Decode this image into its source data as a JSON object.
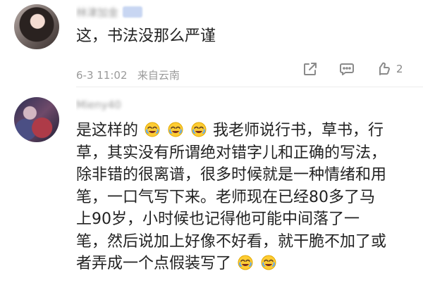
{
  "comments": [
    {
      "username": "林津加金",
      "text": "这，书法没那么严谨",
      "date": "6-3 11:02",
      "source": "来自云南",
      "likes": "2"
    },
    {
      "username": "Mieny40",
      "text_lines": [
        "是这样的",
        "我老师说行书，草书，行",
        "草，其实没有所谓绝对错字儿和正确的写法，",
        "除非错的很离谱，很多时候就是一种情绪和用",
        "笔，一口气写下来。老师现在已经80多了马",
        "上90岁，小时候也记得他可能中间落了一",
        "笔，然后说加上好像不好看，就干脆不加了或",
        "者弄成一个点假装写了"
      ]
    }
  ]
}
